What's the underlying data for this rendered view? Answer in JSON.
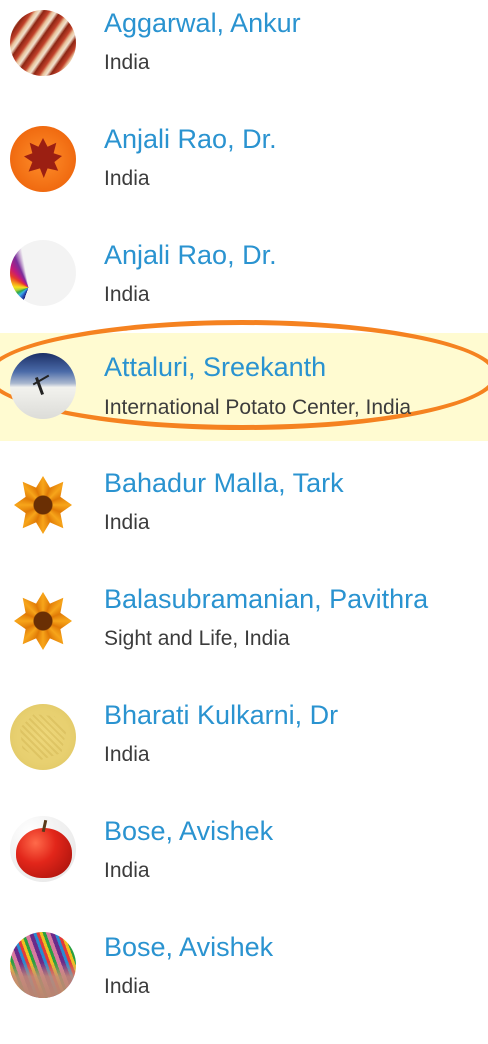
{
  "people": [
    {
      "name": "Aggarwal, Ankur",
      "affiliation": "India",
      "avatar_icon": "pencils-avatar-icon"
    },
    {
      "name": "Anjali Rao, Dr.",
      "affiliation": "India",
      "avatar_icon": "maple-leaf-avatar-icon"
    },
    {
      "name": "Anjali Rao, Dr.",
      "affiliation": "India",
      "avatar_icon": "color-pencils-fan-avatar-icon"
    },
    {
      "name": "Attaluri, Sreekanth",
      "affiliation": "International Potato Center, India",
      "avatar_icon": "desert-figure-avatar-icon"
    },
    {
      "name": "Bahadur Malla, Tark",
      "affiliation": "India",
      "avatar_icon": "orange-flower-avatar-icon"
    },
    {
      "name": "Balasubramanian, Pavithra",
      "affiliation": "Sight and Life, India",
      "avatar_icon": "orange-flower-avatar-icon"
    },
    {
      "name": "Bharati Kulkarni, Dr",
      "affiliation": "India",
      "avatar_icon": "yellow-texture-avatar-icon"
    },
    {
      "name": "Bose, Avishek",
      "affiliation": "India",
      "avatar_icon": "red-apple-avatar-icon"
    },
    {
      "name": "Bose, Avishek",
      "affiliation": "India",
      "avatar_icon": "hand-pencils-avatar-icon"
    }
  ],
  "colors": {
    "name_link": "#2a93d0",
    "affiliation_text": "#3c3c3c",
    "highlight_background": "#fffbd1",
    "highlight_ring": "#f58220"
  }
}
